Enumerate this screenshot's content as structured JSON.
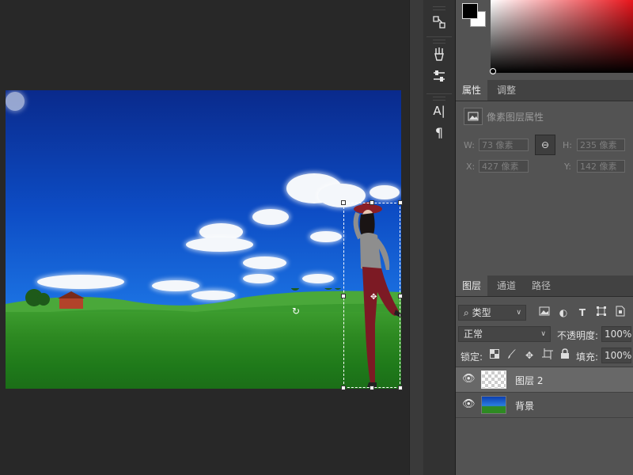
{
  "tools": {
    "icons": [
      "path-select-icon",
      "brush-preset-icon",
      "adjust-sliders-icon",
      "character-icon",
      "paragraph-icon"
    ],
    "character_glyph": "A|",
    "paragraph_glyph": "¶"
  },
  "colors": {
    "foreground": "#000000",
    "background": "#ffffff"
  },
  "properties": {
    "tabs": [
      "属性",
      "调整"
    ],
    "title": "像素图层属性",
    "w_label": "W:",
    "w_value": "73 像素",
    "h_label": "H:",
    "h_value": "235 像素",
    "x_label": "X:",
    "x_value": "427 像素",
    "y_label": "Y:",
    "y_value": "142 像素"
  },
  "layers": {
    "tabs": [
      "图层",
      "通道",
      "路径"
    ],
    "filter_kind": "类型",
    "blend_mode": "正常",
    "opacity_label": "不透明度:",
    "opacity_value": "100%",
    "lock_label": "锁定:",
    "fill_label": "填充:",
    "fill_value": "100%",
    "items": [
      {
        "name": "图层 2",
        "selected": true
      },
      {
        "name": "背景",
        "selected": false
      }
    ]
  }
}
